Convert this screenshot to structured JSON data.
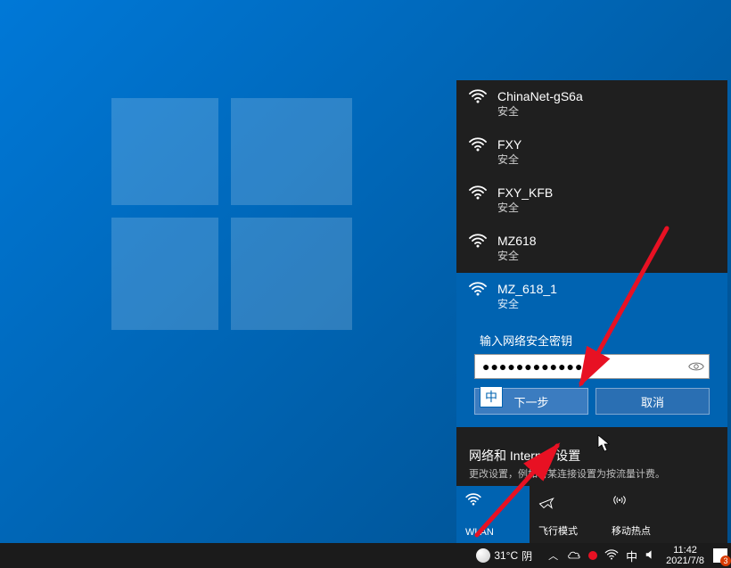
{
  "networks": [
    {
      "name": "ChinaNet-gS6a",
      "security": "安全"
    },
    {
      "name": "FXY",
      "security": "安全"
    },
    {
      "name": "FXY_KFB",
      "security": "安全"
    },
    {
      "name": "MZ618",
      "security": "安全"
    }
  ],
  "selected_network": {
    "name": "MZ_618_1",
    "security": "安全",
    "password_prompt": "输入网络安全密钥",
    "password_value": "●●●●●●●●●●●●",
    "next_button": "下一步",
    "cancel_button": "取消"
  },
  "ime_badge": "中",
  "settings": {
    "title": "网络和 Internet 设置",
    "subtitle": "更改设置，例如将某连接设置为按流量计费。"
  },
  "tiles": {
    "wlan": "WLAN",
    "airplane": "飞行模式",
    "hotspot": "移动热点"
  },
  "taskbar": {
    "weather_temp": "31°C",
    "weather_cond": "阴",
    "ime": "中",
    "time": "11:42",
    "date": "2021/7/8",
    "notif_count": "3"
  }
}
